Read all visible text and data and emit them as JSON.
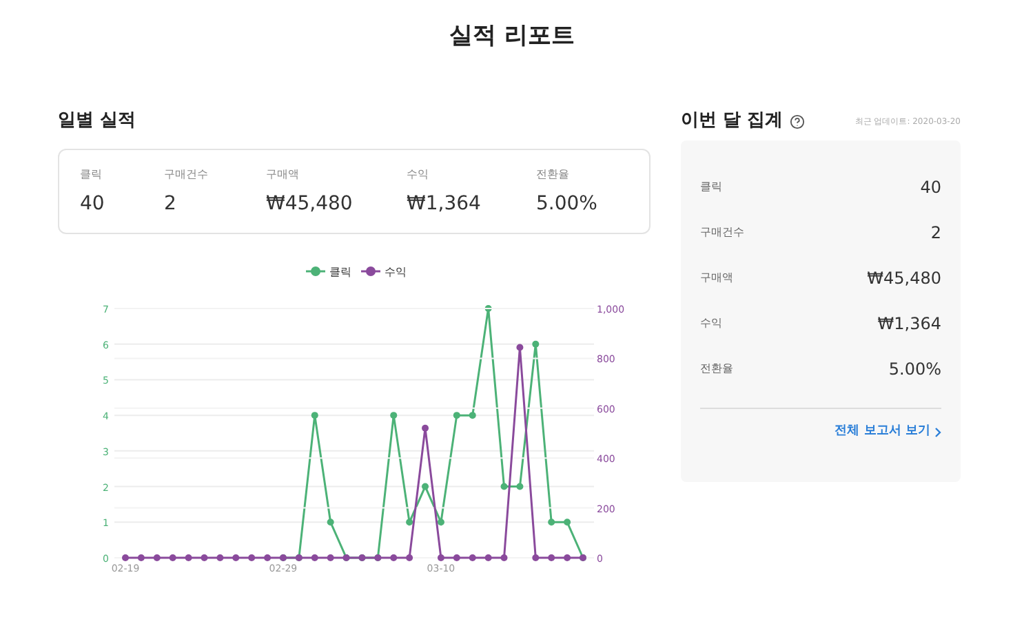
{
  "page_title": "실적 리포트",
  "daily": {
    "title": "일별 실적",
    "stats": [
      {
        "label": "클릭",
        "value": "40"
      },
      {
        "label": "구매건수",
        "value": "2"
      },
      {
        "label": "구매액",
        "value": "₩45,480"
      },
      {
        "label": "수익",
        "value": "₩1,364"
      },
      {
        "label": "전환율",
        "value": "5.00%"
      }
    ],
    "click_chart": {
      "chart_data": {
        "type": "line",
        "grid": true,
        "categories": [
          "02-19",
          null,
          null,
          null,
          null,
          null,
          null,
          null,
          null,
          null,
          "02-29",
          null,
          null,
          null,
          null,
          null,
          null,
          null,
          null,
          null,
          "03-10",
          null,
          null,
          null,
          null,
          null,
          null,
          null,
          null,
          null
        ],
        "ylim": [
          0,
          7
        ],
        "yticks": [
          0,
          1,
          2,
          3,
          4,
          5,
          6,
          7
        ],
        "series": [
          {
            "name": "클릭",
            "color": "#4cb277",
            "marker": "circle",
            "values": [
              null,
              null,
              null,
              null,
              null,
              null,
              null,
              null,
              null,
              null,
              0,
              0,
              4,
              1,
              0,
              0,
              0,
              4,
              1,
              2,
              1,
              4,
              4,
              7,
              2,
              2,
              6,
              1,
              1,
              0
            ]
          }
        ]
      }
    },
    "revenue_chart": {
      "chart_data": {
        "type": "line",
        "grid": true,
        "categories": [
          null,
          null,
          null,
          null,
          null,
          null,
          null,
          null,
          null,
          null,
          null,
          null,
          null,
          null,
          null,
          null,
          null,
          null,
          null,
          null,
          null,
          null,
          null,
          null,
          null,
          null,
          null,
          null,
          null,
          null
        ],
        "ylim": [
          0,
          1000
        ],
        "yticks": [
          {
            "value": 0,
            "label": "0"
          },
          {
            "value": 200,
            "label": "200"
          },
          {
            "value": 400,
            "label": "400"
          },
          {
            "value": 600,
            "label": "600"
          },
          {
            "value": 800,
            "label": "800"
          },
          {
            "value": 1000,
            "label": "1,000"
          }
        ],
        "series": [
          {
            "name": "수익",
            "color": "#8a4a9c",
            "marker": "circle",
            "values": [
              0,
              0,
              0,
              0,
              0,
              0,
              0,
              0,
              0,
              0,
              0,
              0,
              0,
              0,
              0,
              0,
              0,
              0,
              0,
              520,
              0,
              0,
              0,
              0,
              0,
              844,
              0,
              0,
              0,
              0
            ]
          }
        ]
      }
    }
  },
  "monthly": {
    "title": "이번 달 집계",
    "updated": "최근 업데이트: 2020-03-20",
    "rows": [
      {
        "label": "클릭",
        "value": "40"
      },
      {
        "label": "구매건수",
        "value": "2"
      },
      {
        "label": "구매액",
        "value": "₩45,480"
      },
      {
        "label": "수익",
        "value": "₩1,364"
      },
      {
        "label": "전환율",
        "value": "5.00%"
      }
    ],
    "link": "전체 보고서 보기"
  }
}
